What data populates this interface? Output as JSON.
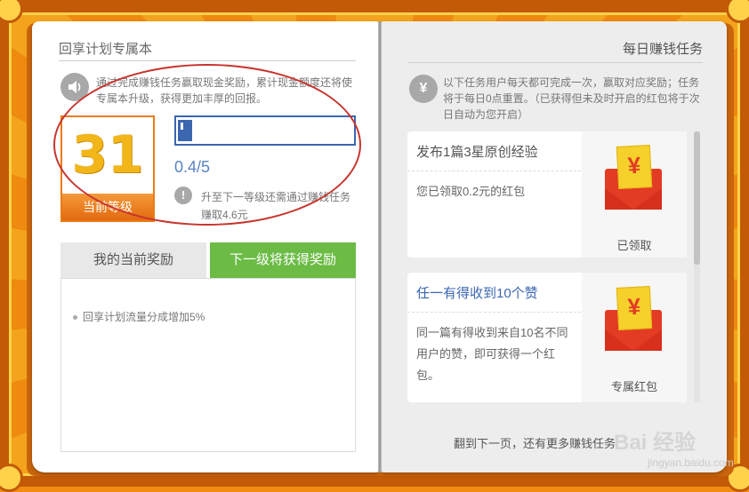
{
  "left_page": {
    "title": "回享计划专属本",
    "intro_icon": "sound-icon",
    "intro": "通过完成赚钱任务赢取现金奖励，累计现金额度还将使专属本升级，获得更加丰厚的回报。",
    "level": {
      "number": "31",
      "label": "当前等级"
    },
    "progress": {
      "current": 0.4,
      "total": 5,
      "text": "0.4/5"
    },
    "hint_icon": "exclamation-icon",
    "hint": "升至下一等级还需通过赚钱任务赚取4.6元",
    "tabs": [
      {
        "label": "我的当前奖励",
        "active": false
      },
      {
        "label": "下一级将获得奖励",
        "active": true
      }
    ],
    "rewards": [
      "回享计划流量分成增加5%"
    ]
  },
  "right_page": {
    "title": "每日赚钱任务",
    "intro_icon": "yen-icon",
    "intro": "以下任务用户每天都可完成一次，赢取对应奖励；任务将于每日0点重置。（已获得但未及时开启的红包将于次日自动为您开启）",
    "tasks": [
      {
        "title": "发布1篇3星原创经验",
        "desc": "您已领取0.2元的红包",
        "status": "已领取",
        "title_color": "#555555"
      },
      {
        "title": "任一有得收到10个赞",
        "desc": "同一篇有得收到来自10名不同用户的赞，即可获得一个红包。",
        "status": "专属红包",
        "title_color": "#3b66b0"
      }
    ],
    "envelope_symbol": "¥",
    "footer": "翻到下一页，还有更多赚钱任务"
  },
  "watermark": {
    "logo": "Bai 经验",
    "sub": "jingyan.baidu.com"
  },
  "colors": {
    "accent_orange": "#e97b16",
    "progress_blue": "#3b66b0",
    "tab_green": "#6bbb45",
    "annotation_red": "#c8342e"
  }
}
